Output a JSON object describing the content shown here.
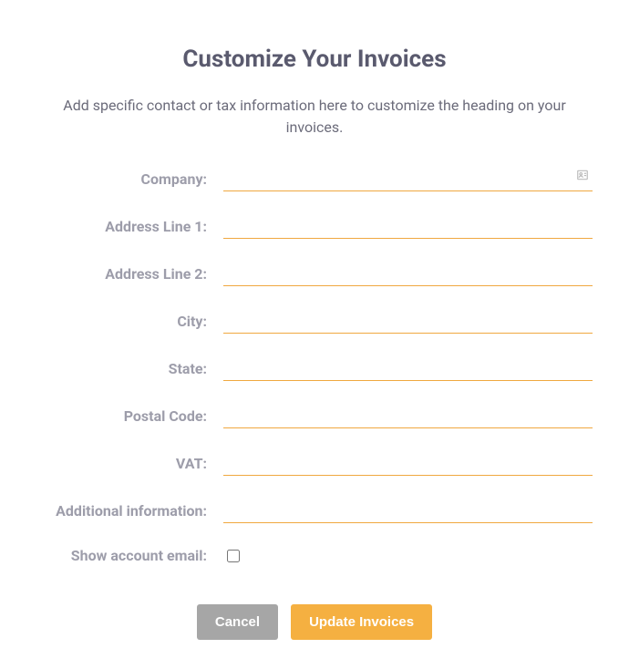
{
  "title": "Customize Your Invoices",
  "subtitle": "Add specific contact or tax information here to customize the heading on your invoices.",
  "fields": {
    "company": {
      "label": "Company:",
      "value": ""
    },
    "address1": {
      "label": "Address Line 1:",
      "value": ""
    },
    "address2": {
      "label": "Address Line 2:",
      "value": ""
    },
    "city": {
      "label": "City:",
      "value": ""
    },
    "state": {
      "label": "State:",
      "value": ""
    },
    "postal": {
      "label": "Postal Code:",
      "value": ""
    },
    "vat": {
      "label": "VAT:",
      "value": ""
    },
    "additional": {
      "label": "Additional information:",
      "value": ""
    },
    "showEmail": {
      "label": "Show account email:",
      "checked": false
    }
  },
  "buttons": {
    "cancel": "Cancel",
    "update": "Update Invoices"
  }
}
